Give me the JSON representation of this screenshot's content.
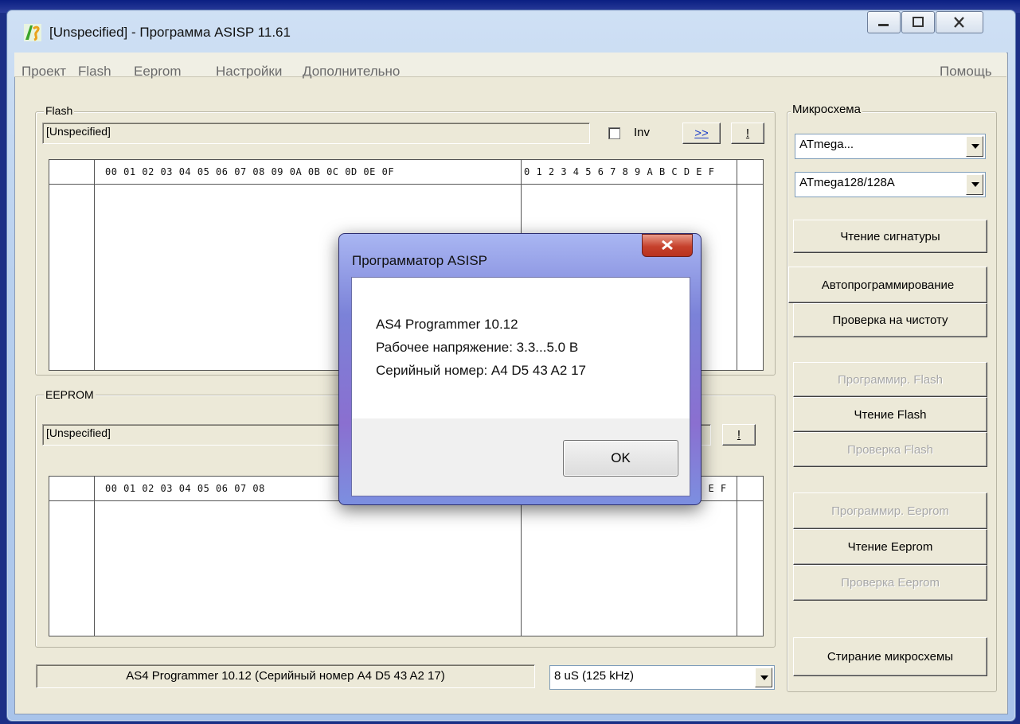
{
  "window": {
    "title": "[Unspecified] - Программа ASISP 11.61",
    "icon_text": "AS"
  },
  "menu": {
    "items": [
      "Проект",
      "Flash",
      "Eeprom",
      "Настройки",
      "Дополнительно"
    ],
    "help": "Помощь"
  },
  "flash": {
    "label": "Flash",
    "file": "[Unspecified]",
    "inv_label": "Inv",
    "btn_forward": ">>",
    "btn_excl": "!",
    "hex_header": "00 01 02 03 04 05 06 07 08 09 0A 0B 0C 0D 0E 0F",
    "ascii_header": "0 1 2 3 4 5 6 7 8 9 A B C D E F"
  },
  "eeprom": {
    "label": "EEPROM",
    "file": "[Unspecified]",
    "btn_excl": "!",
    "hex_header": "00 01 02 03 04 05 06 07 08",
    "ascii_tail": "D E F"
  },
  "chip": {
    "label": "Микросхема",
    "family": "ATmega...",
    "model": "ATmega128/128A",
    "buttons": {
      "read_signature": "Чтение сигнатуры",
      "auto_program": "Автопрограммирование",
      "blank_check": "Проверка на чистоту",
      "program_flash": "Программир. Flash",
      "read_flash": "Чтение Flash",
      "verify_flash": "Проверка Flash",
      "program_eeprom": "Программир. Eeprom",
      "read_eeprom": "Чтение Eeprom",
      "verify_eeprom": "Проверка Eeprom",
      "erase_chip": "Стирание микросхемы"
    }
  },
  "status": {
    "programmer": "AS4 Programmer 10.12 (Серийный номер A4 D5 43 A2 17)",
    "speed": "8 uS (125 kHz)"
  },
  "dialog": {
    "title": "Программатор ASISP",
    "line1": "AS4 Programmer 10.12",
    "line2": "Рабочее напряжение: 3.3...5.0 В",
    "line3": "Серийный номер: A4 D5 43 A2 17",
    "ok": "OK"
  },
  "colors": {
    "accent_green": "#3aa52a",
    "disabled_text": "#a8a8a8",
    "dialog_frame": "#7b82d8"
  }
}
